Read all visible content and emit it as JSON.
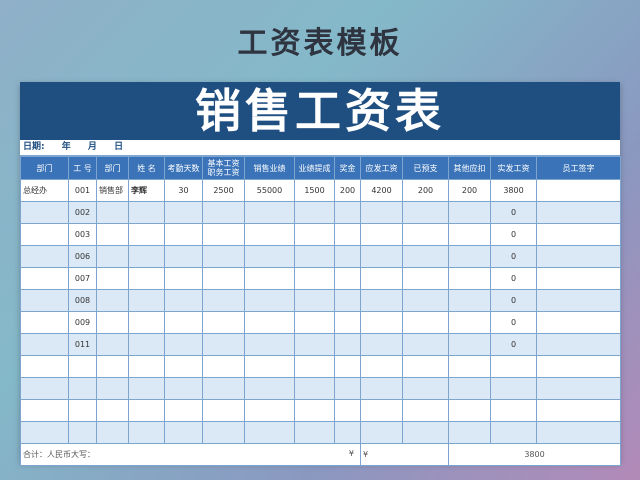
{
  "heading": "工资表模板",
  "banner_title": "销售工资表",
  "date_row": {
    "label": "日期:",
    "year": "年",
    "month": "月",
    "day": "日"
  },
  "columns": [
    "部门",
    "工  号",
    "部门",
    "姓  名",
    "考勤天数",
    "基本工资\n职务工资",
    "销售业绩",
    "业绩提成",
    "奖金",
    "应发工资",
    "已预支",
    "其他应扣",
    "实发工资",
    "员工签字"
  ],
  "rows": [
    [
      "总经办",
      "001",
      "销售部",
      "李辉",
      "30",
      "2500",
      "55000",
      "1500",
      "200",
      "4200",
      "200",
      "200",
      "3800",
      ""
    ],
    [
      "",
      "002",
      "",
      "",
      "",
      "",
      "",
      "",
      "",
      "",
      "",
      "",
      "0",
      ""
    ],
    [
      "",
      "003",
      "",
      "",
      "",
      "",
      "",
      "",
      "",
      "",
      "",
      "",
      "0",
      ""
    ],
    [
      "",
      "006",
      "",
      "",
      "",
      "",
      "",
      "",
      "",
      "",
      "",
      "",
      "0",
      ""
    ],
    [
      "",
      "007",
      "",
      "",
      "",
      "",
      "",
      "",
      "",
      "",
      "",
      "",
      "0",
      ""
    ],
    [
      "",
      "008",
      "",
      "",
      "",
      "",
      "",
      "",
      "",
      "",
      "",
      "",
      "0",
      ""
    ],
    [
      "",
      "009",
      "",
      "",
      "",
      "",
      "",
      "",
      "",
      "",
      "",
      "",
      "0",
      ""
    ],
    [
      "",
      "011",
      "",
      "",
      "",
      "",
      "",
      "",
      "",
      "",
      "",
      "",
      "0",
      ""
    ],
    [
      "",
      "",
      "",
      "",
      "",
      "",
      "",
      "",
      "",
      "",
      "",
      "",
      "",
      ""
    ],
    [
      "",
      "",
      "",
      "",
      "",
      "",
      "",
      "",
      "",
      "",
      "",
      "",
      "",
      ""
    ],
    [
      "",
      "",
      "",
      "",
      "",
      "",
      "",
      "",
      "",
      "",
      "",
      "",
      "",
      ""
    ],
    [
      "",
      "",
      "",
      "",
      "",
      "",
      "",
      "",
      "",
      "",
      "",
      "",
      "",
      ""
    ]
  ],
  "footer": {
    "label": "合计：人民币大写：",
    "yen1": "¥",
    "yen2": "¥",
    "total": "3800"
  }
}
